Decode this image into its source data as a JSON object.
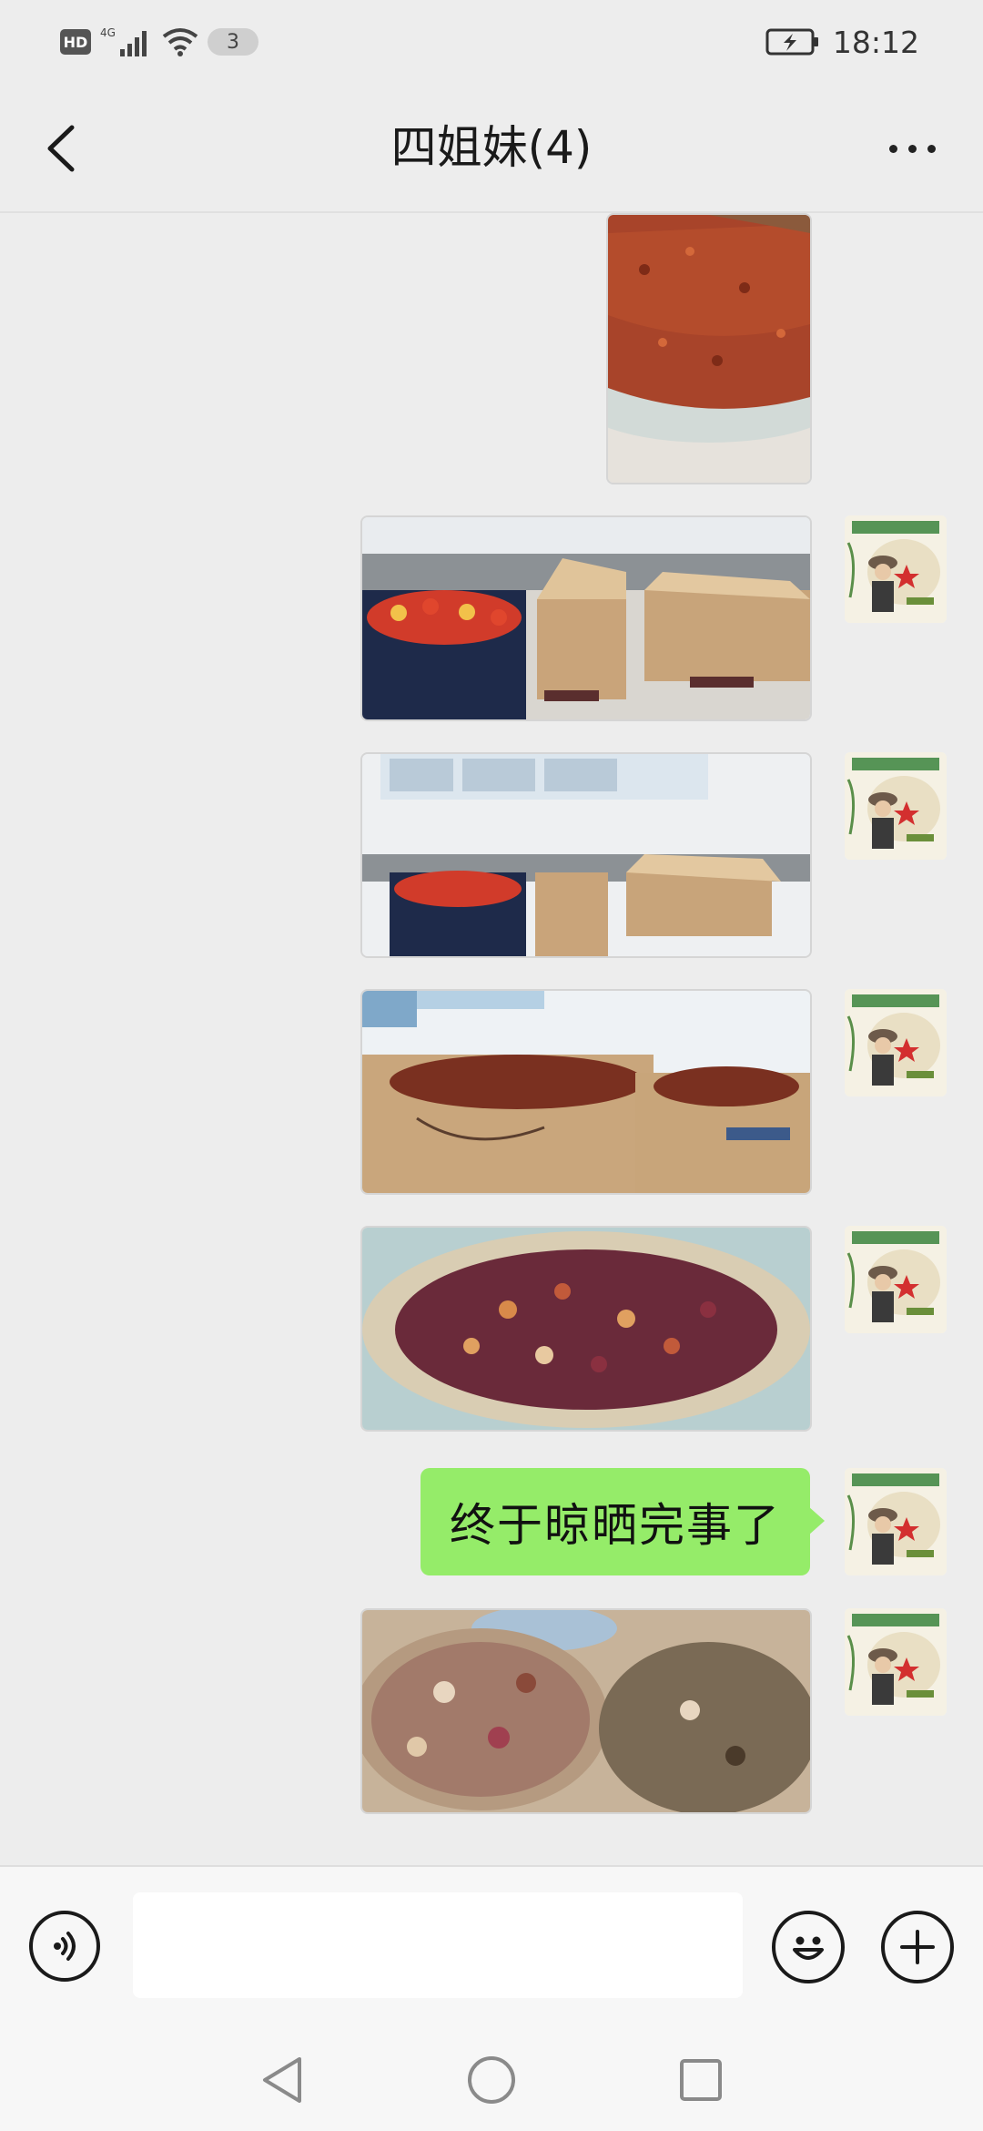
{
  "status_bar": {
    "hd_label": "HD",
    "network_label": "4G",
    "notification_count": "3",
    "time": "18:12"
  },
  "header": {
    "title": "四姐妹(4)",
    "back_icon": "chevron-left-icon",
    "more_icon": "more-dots-icon"
  },
  "messages": {
    "text_message": "终于晾晒完事了"
  },
  "input_bar": {
    "message_value": "",
    "voice_icon": "voice-icon",
    "emoji_icon": "emoji-icon",
    "plus_icon": "plus-icon"
  },
  "nav_bar": {
    "back_icon": "nav-back-icon",
    "home_icon": "nav-home-icon",
    "recents_icon": "nav-recents-icon"
  },
  "colors": {
    "background": "#ededed",
    "bubble": "#95ec69",
    "input_bar": "#f7f7f7"
  }
}
